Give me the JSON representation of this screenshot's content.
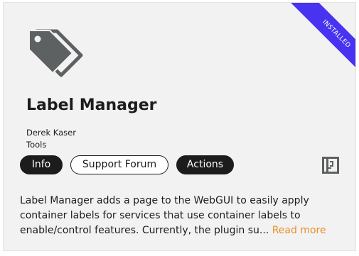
{
  "card": {
    "ribbon": "INSTALLED",
    "title": "Label Manager",
    "author": "Derek Kaser",
    "category": "Tools",
    "icon": "label-tags-icon",
    "buttons": {
      "info": "Info",
      "support": "Support Forum",
      "actions": "Actions"
    },
    "side_icon": "support-box-icon",
    "description": "Label Manager adds a page to the WebGUI to easily apply container labels for services that use container labels to enable/control features. Currently, the plugin su... ",
    "read_more": "Read more"
  },
  "colors": {
    "ribbon": "#4733f0",
    "accent": "#e8902a",
    "dark": "#1c1c1c",
    "card_bg": "#f2f2f2"
  }
}
